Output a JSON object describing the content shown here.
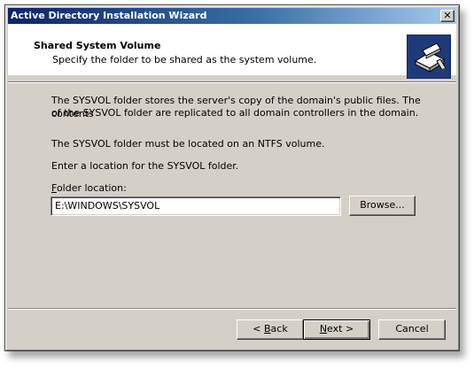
{
  "window": {
    "title": "Active Directory Installation Wizard",
    "close_glyph": "✕"
  },
  "header": {
    "title": "Shared System Volume",
    "subtitle": "Specify the folder to be shared as the system volume."
  },
  "body": {
    "para1_line1": "The SYSVOL folder stores the server's copy of the domain's public files. The contents",
    "para1_line2": "of the SYSVOL folder are replicated to all domain controllers in the domain.",
    "para2": "The SYSVOL folder must be located on an NTFS volume.",
    "para3": "Enter a location for the SYSVOL folder.",
    "folder_label_hotkey": "F",
    "folder_label_rest": "older location:",
    "folder_value": "E:\\WINDOWS\\SYSVOL",
    "browse_label": "Browse..."
  },
  "footer": {
    "back_prefix": "< ",
    "back_hotkey": "B",
    "back_rest": "ack",
    "next_hotkey": "N",
    "next_rest": "ext >",
    "cancel_label": "Cancel"
  },
  "colors": {
    "title_gradient_start": "#0a246a",
    "title_gradient_end": "#a6caf0",
    "dialog_face": "#d4d0c8",
    "header_icon_bg": "#1f3a7a"
  },
  "icons": [
    "close-icon",
    "wizard-book-icon"
  ]
}
